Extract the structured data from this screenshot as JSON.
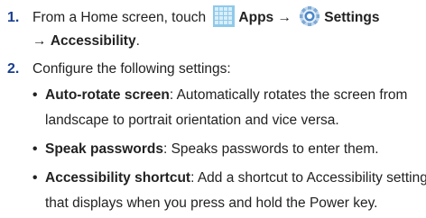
{
  "step1": {
    "number": "1.",
    "text_prefix": "From a Home screen, touch",
    "apps_label": "Apps",
    "arrow1": "→",
    "settings_label": "Settings",
    "arrow2": "→",
    "accessibility_label": "Accessibility",
    "period": ".",
    "apps_icon": "apps-grid-icon",
    "settings_icon": "settings-gear-icon"
  },
  "step2": {
    "number": "2.",
    "text": "Configure the following settings:"
  },
  "bullets": [
    {
      "title": "Auto-rotate screen",
      "line1": ": Automatically rotates the screen from",
      "line2": "landscape to portrait orientation and vice versa."
    },
    {
      "title": "Speak passwords",
      "line1": ": Speaks passwords to enter them."
    },
    {
      "title": "Accessibility shortcut",
      "line1": ": Add a shortcut to Accessibility settings",
      "line2": "that displays when you press and hold the Power key."
    }
  ],
  "colors": {
    "number": "#1a3f8f",
    "apps_icon": "#8fc9ea",
    "settings_icon": "#4a86c8"
  }
}
